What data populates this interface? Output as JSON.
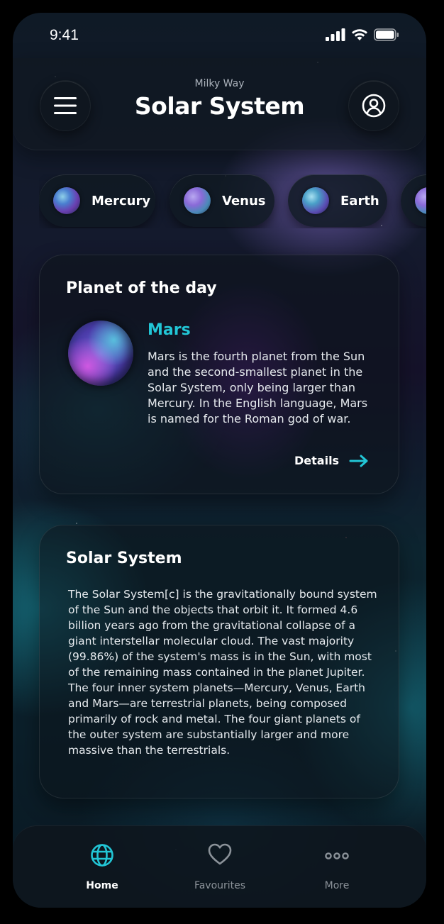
{
  "status_bar": {
    "time": "9:41"
  },
  "header": {
    "subtitle": "Milky Way",
    "title": "Solar System",
    "menu_icon": "hamburger-menu-icon",
    "profile_icon": "user-circle-icon"
  },
  "planet_chips": [
    {
      "label": "Mercury"
    },
    {
      "label": "Venus"
    },
    {
      "label": "Earth"
    }
  ],
  "planet_of_the_day": {
    "heading": "Planet of the day",
    "planet_name": "Mars",
    "description": "Mars is the fourth planet from the Sun and the second-smallest planet in the Solar System, only being larger than Mercury. In the English language, Mars is named for the Roman god of war.",
    "details_label": "Details"
  },
  "solar_system_card": {
    "heading": "Solar System",
    "description": "The Solar System[c] is the gravitationally bound system of the Sun and the objects that orbit it. It formed 4.6 billion years ago from the gravitational collapse of a giant interstellar molecular cloud. The vast majority (99.86%) of the system's mass is in the Sun, with most of the remaining mass contained in the planet Jupiter. The four inner system planets—Mercury, Venus, Earth and Mars—are terrestrial planets, being composed primarily of rock and metal. The four giant planets of the outer system are substantially larger and more massive than the terrestrials."
  },
  "tab_bar": {
    "home_label": "Home",
    "favourites_label": "Favourites",
    "more_label": "More",
    "active_tab": "Home"
  },
  "colors": {
    "accent": "#22c6d6",
    "card_background": "#0c141c",
    "inactive_tab": "#8b9299"
  }
}
